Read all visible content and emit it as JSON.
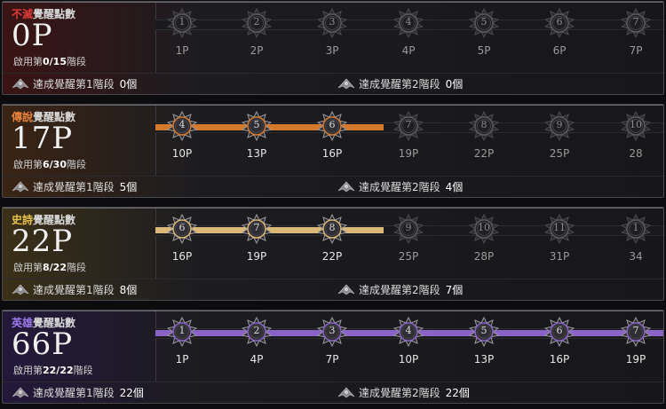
{
  "panels": [
    {
      "title": "不滅覺醒點數",
      "title_color": "#e03a3a",
      "title_prefix": "不滅",
      "title_suffix": "覺醒點數",
      "points": "0P",
      "stage_prefix": "啟用第",
      "stage_value": "0/15",
      "stage_suffix": "階段",
      "progress_fill_color": null,
      "progress_fraction": 0,
      "nodes": [
        {
          "num": "1",
          "cost": "1P",
          "active": false
        },
        {
          "num": "2",
          "cost": "2P",
          "active": false
        },
        {
          "num": "3",
          "cost": "3P",
          "active": false
        },
        {
          "num": "4",
          "cost": "4P",
          "active": false
        },
        {
          "num": "5",
          "cost": "5P",
          "active": false
        },
        {
          "num": "6",
          "cost": "6P",
          "active": false
        },
        {
          "num": "7",
          "cost": "7P",
          "active": false
        }
      ],
      "ach1_label": "達成覺醒第1階段",
      "ach1_count": "0個",
      "ach2_label": "達成覺醒第2階段",
      "ach2_count": "0個"
    },
    {
      "title_prefix": "傳說",
      "title_suffix": "覺醒點數",
      "title_color": "#e8823a",
      "points": "17P",
      "stage_prefix": "啟用第",
      "stage_value": "6/30",
      "stage_suffix": "階段",
      "progress_fill_color": "#d4782c",
      "nodes": [
        {
          "num": "4",
          "cost": "10P",
          "active": true
        },
        {
          "num": "5",
          "cost": "13P",
          "active": true
        },
        {
          "num": "6",
          "cost": "16P",
          "active": true
        },
        {
          "num": "7",
          "cost": "19P",
          "active": false
        },
        {
          "num": "8",
          "cost": "22P",
          "active": false
        },
        {
          "num": "9",
          "cost": "25P",
          "active": false
        },
        {
          "num": "10",
          "cost": "28",
          "active": false
        }
      ],
      "ach1_label": "達成覺醒第1階段",
      "ach1_count": "5個",
      "ach2_label": "達成覺醒第2階段",
      "ach2_count": "4個"
    },
    {
      "title_prefix": "史詩",
      "title_suffix": "覺醒點數",
      "title_color": "#e8c24a",
      "points": "22P",
      "stage_prefix": "啟用第",
      "stage_value": "8/22",
      "stage_suffix": "階段",
      "progress_fill_color": "#d9b878",
      "nodes": [
        {
          "num": "6",
          "cost": "16P",
          "active": true
        },
        {
          "num": "7",
          "cost": "19P",
          "active": true
        },
        {
          "num": "8",
          "cost": "22P",
          "active": true
        },
        {
          "num": "9",
          "cost": "25P",
          "active": false
        },
        {
          "num": "10",
          "cost": "28P",
          "active": false
        },
        {
          "num": "11",
          "cost": "31P",
          "active": false
        },
        {
          "num": "1",
          "cost": "34",
          "active": false
        }
      ],
      "ach1_label": "達成覺醒第1階段",
      "ach1_count": "8個",
      "ach2_label": "達成覺醒第2階段",
      "ach2_count": "7個"
    },
    {
      "title_prefix": "英雄",
      "title_suffix": "覺醒點數",
      "title_color": "#9a78e8",
      "points": "66P",
      "stage_prefix": "啟用第",
      "stage_value": "22/22",
      "stage_suffix": "階段",
      "progress_fill_color": "#8a63c8",
      "nodes": [
        {
          "num": "1",
          "cost": "1P",
          "active": true
        },
        {
          "num": "2",
          "cost": "4P",
          "active": true
        },
        {
          "num": "3",
          "cost": "7P",
          "active": true
        },
        {
          "num": "4",
          "cost": "10P",
          "active": true
        },
        {
          "num": "5",
          "cost": "13P",
          "active": true
        },
        {
          "num": "6",
          "cost": "16P",
          "active": true
        },
        {
          "num": "7",
          "cost": "19P",
          "active": true
        }
      ],
      "ach1_label": "達成覺醒第1階段",
      "ach1_count": "22個",
      "ach2_label": "達成覺醒第2階段",
      "ach2_count": "22個"
    }
  ]
}
